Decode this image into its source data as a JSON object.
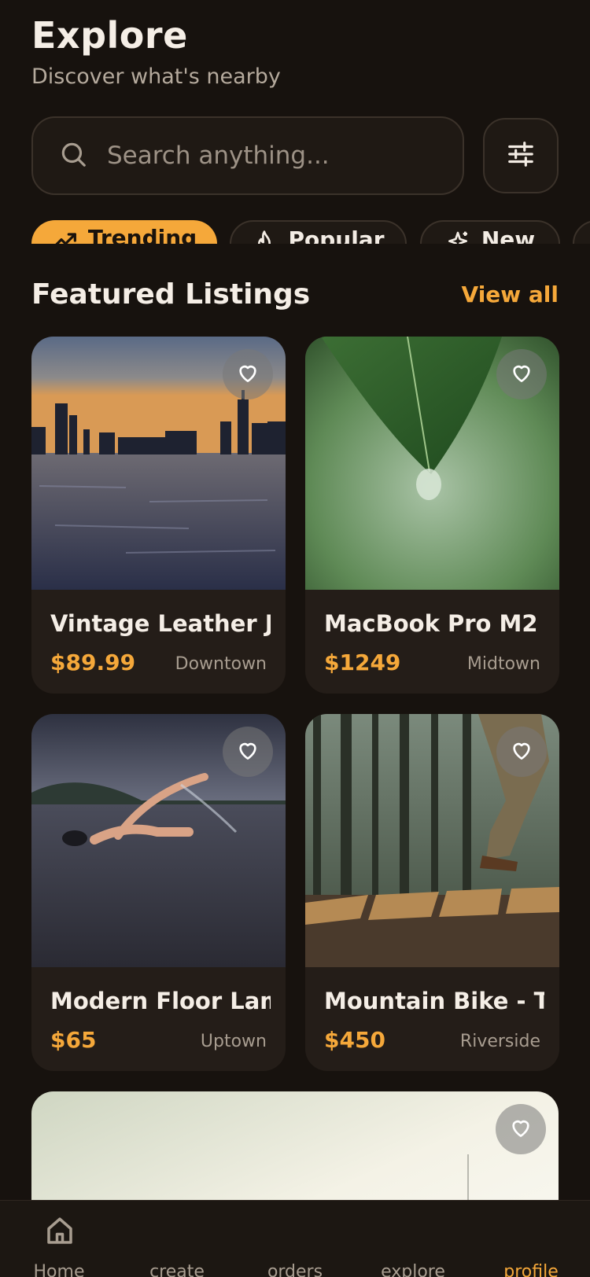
{
  "header": {
    "title": "Explore",
    "subtitle": "Discover what's nearby"
  },
  "search": {
    "placeholder": "Search anything..."
  },
  "chips": [
    {
      "label": "Trending",
      "icon": "trending-up-icon",
      "active": true
    },
    {
      "label": "Popular",
      "icon": "flame-icon",
      "active": false
    },
    {
      "label": "New",
      "icon": "sparkles-icon",
      "active": false
    }
  ],
  "section": {
    "title": "Featured Listings",
    "view_all": "View all"
  },
  "listings": [
    {
      "name": "Vintage Leather J...",
      "price": "$89.99",
      "location": "Downtown",
      "image": "city-skyline-at-dusk-over-water"
    },
    {
      "name": "MacBook Pro M2 ...",
      "price": "$1249",
      "location": "Midtown",
      "image": "green-leaf-with-water-droplet"
    },
    {
      "name": "Modern Floor Lamp",
      "price": "$65",
      "location": "Uptown",
      "image": "swimmer-in-open-water"
    },
    {
      "name": "Mountain Bike - T...",
      "price": "$450",
      "location": "Riverside",
      "image": "hiker-on-wooden-boardwalk-in-forest"
    },
    {
      "name": "",
      "price": "",
      "location": "",
      "image": "bright-hazy-landscape"
    }
  ],
  "nav": [
    {
      "label": "Home",
      "icon": "home-icon",
      "active": false
    },
    {
      "label": "create",
      "icon": "",
      "active": false
    },
    {
      "label": "orders",
      "icon": "",
      "active": false
    },
    {
      "label": "explore",
      "icon": "",
      "active": false
    },
    {
      "label": "profile",
      "icon": "",
      "active": true
    }
  ],
  "colors": {
    "accent": "#f5a83a",
    "background": "#17120e",
    "card": "#241d18"
  }
}
